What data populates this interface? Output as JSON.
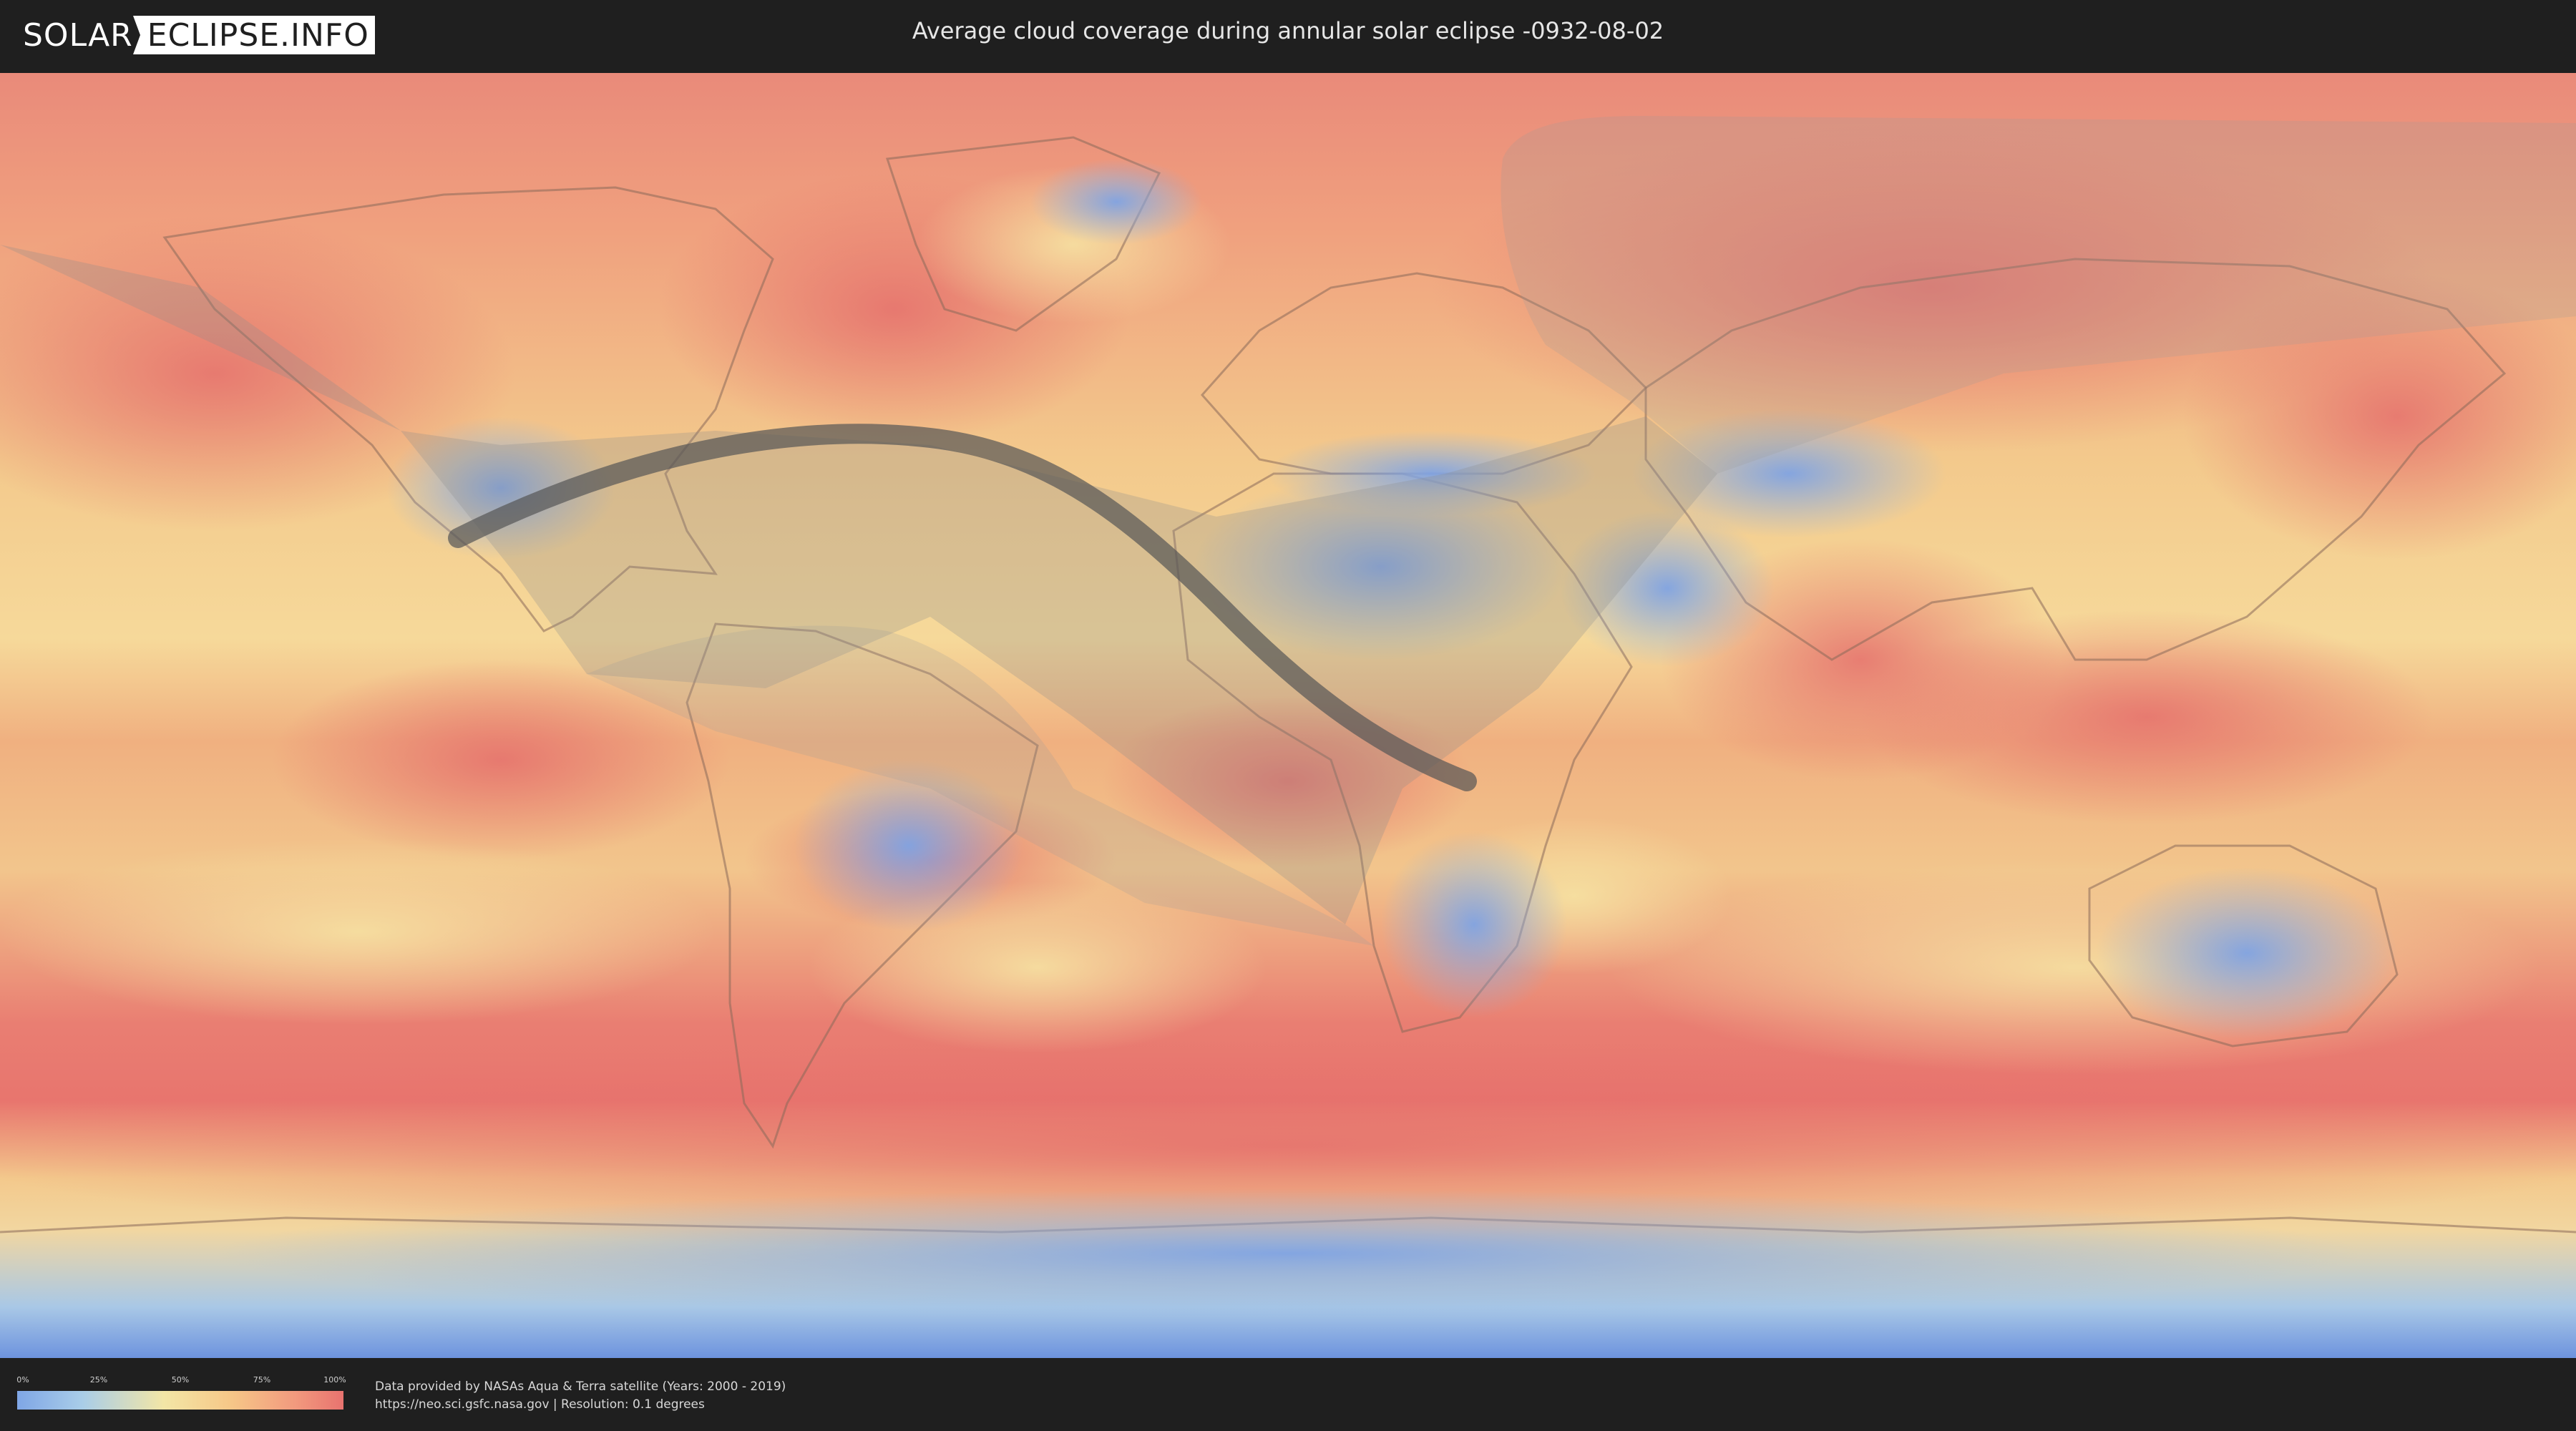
{
  "header": {
    "logo_part1": "SOLAR",
    "logo_part2": "ECLIPSE.INFO",
    "title": "Average cloud coverage during annular solar eclipse -0932-08-02"
  },
  "map": {
    "layer": "average cloud coverage",
    "overlays": [
      "penumbral-shadow-region",
      "annular-eclipse-path"
    ]
  },
  "legend": {
    "ticks": [
      "0%",
      "25%",
      "50%",
      "75%",
      "100%"
    ],
    "gradient_colors": [
      "#7fa6e6",
      "#a9cde8",
      "#f3e6a6",
      "#f6c888",
      "#f29a7e",
      "#e8736f"
    ]
  },
  "footer": {
    "credit_line1": "Data provided by NASAs Aqua & Terra satellite (Years: 2000 - 2019)",
    "credit_line2": "https://neo.sci.gsfc.nasa.gov | Resolution: 0.1 degrees"
  }
}
